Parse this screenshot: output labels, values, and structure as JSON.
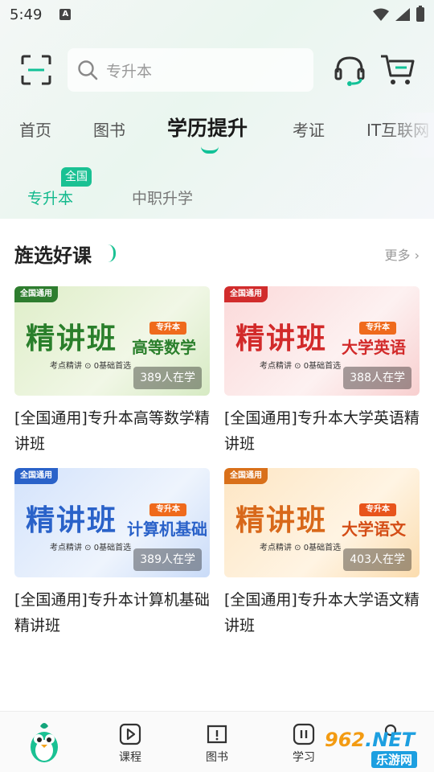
{
  "status_bar": {
    "time": "5:49",
    "notif_letter": "A"
  },
  "search": {
    "placeholder": "专升本"
  },
  "category_tabs": [
    {
      "label": "首页"
    },
    {
      "label": "图书"
    },
    {
      "label": "学历提升",
      "active": true
    },
    {
      "label": "考证"
    },
    {
      "label": "IT互联网"
    }
  ],
  "sub_tabs": {
    "items": [
      {
        "label": "专升本",
        "active": true
      },
      {
        "label": "中职升学"
      }
    ],
    "badge": "全国"
  },
  "section": {
    "title": "旌选好课",
    "more": "更多 ›"
  },
  "courses": [
    {
      "theme": "green",
      "tag": "全国通用",
      "main": "精讲班",
      "pill": "专升本",
      "subject": "高等数学",
      "tags": "考点精讲   ⊙ 0基础首选",
      "enrolled": "389人在学",
      "title": "[全国通用]专升本高等数学精讲班"
    },
    {
      "theme": "red",
      "tag": "全国通用",
      "main": "精讲班",
      "pill": "专升本",
      "subject": "大学英语",
      "tags": "考点精讲   ⊙ 0基础首选",
      "enrolled": "388人在学",
      "title": "[全国通用]专升本大学英语精讲班"
    },
    {
      "theme": "blue",
      "tag": "全国通用",
      "main": "精讲班",
      "pill": "专升本",
      "subject": "计算机基础",
      "tags": "考点精讲   ⊙ 0基础首选",
      "enrolled": "389人在学",
      "title": "[全国通用]专升本计算机基础精讲班"
    },
    {
      "theme": "orange",
      "tag": "全国通用",
      "main": "精讲班",
      "pill": "专升本",
      "subject": "大学语文",
      "tags": "考点精讲   ⊙ 0基础首选",
      "enrolled": "403人在学",
      "title": "[全国通用]专升本大学语文精讲班"
    }
  ],
  "bottom_nav": [
    {
      "label": "",
      "icon": "mascot-icon"
    },
    {
      "label": "课程",
      "icon": "play-icon"
    },
    {
      "label": "图书",
      "icon": "book-icon"
    },
    {
      "label": "学习",
      "icon": "study-icon"
    },
    {
      "label": "",
      "icon": "profile-icon"
    }
  ],
  "watermark": {
    "top": "962",
    "net": ".NET",
    "bottom": "乐游网"
  },
  "colors": {
    "accent": "#11c197"
  }
}
